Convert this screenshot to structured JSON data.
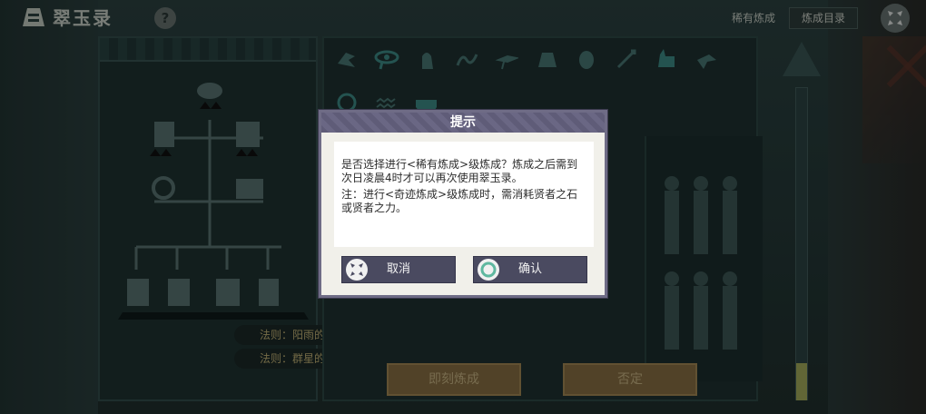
{
  "app": {
    "title": "翠玉录"
  },
  "topbar": {
    "help_label": "?",
    "rare_label": "稀有炼成",
    "catalog_label": "炼成目录"
  },
  "laws": [
    "法则：阳雨的神迹",
    "法则：群星的回音"
  ],
  "bottom_buttons": {
    "confirm_label": "即刻炼成",
    "deny_label": "否定"
  },
  "dialog": {
    "title": "提示",
    "message_line1": "是否选择进行<稀有炼成>级炼成？炼成之后需到次日凌晨4时才可以再次使用翠玉录。",
    "message_line2": "注：进行<奇迹炼成>级炼成时，需消耗贤者之石或贤者之力。",
    "cancel_label": "取消",
    "confirm_label": "确认"
  },
  "progress": {
    "pillar_fill_fraction": 0.12
  },
  "colors": {
    "dialog_header": "#5f5c78",
    "dialog_button": "#4a4a60",
    "gold_button": "#8c7346",
    "glyph_teal": "#3f8f8a"
  }
}
